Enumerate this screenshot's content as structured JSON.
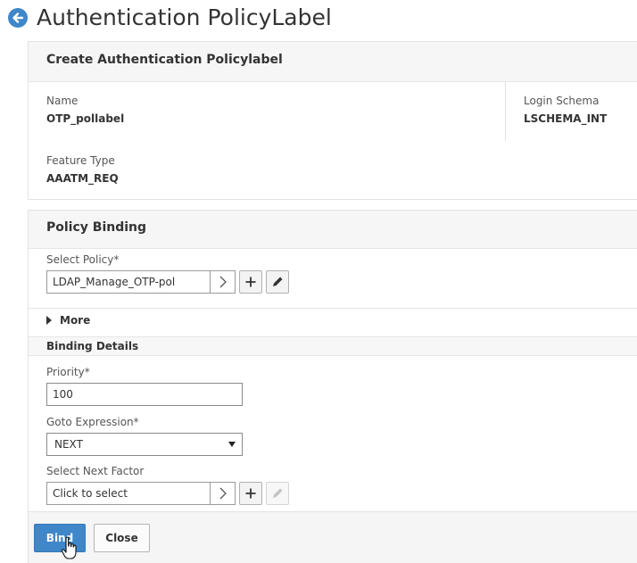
{
  "page": {
    "title": "Authentication PolicyLabel",
    "back_icon": "back-arrow-icon"
  },
  "create_panel": {
    "title": "Create Authentication Policylabel",
    "name_label": "Name",
    "name_value": "OTP_pollabel",
    "login_schema_label": "Login Schema",
    "login_schema_value": "LSCHEMA_INT",
    "feature_type_label": "Feature Type",
    "feature_type_value": "AAATM_REQ"
  },
  "binding_panel": {
    "title": "Policy Binding",
    "select_policy_label": "Select Policy*",
    "select_policy_value": "LDAP_Manage_OTP-pol",
    "more_label": "More",
    "binding_details_label": "Binding Details",
    "priority_label": "Priority*",
    "priority_value": "100",
    "goto_label": "Goto Expression*",
    "goto_value": "NEXT",
    "next_factor_label": "Select Next Factor",
    "next_factor_placeholder": "Click to select"
  },
  "footer": {
    "bind_label": "Bind",
    "close_label": "Close"
  },
  "colors": {
    "accent": "#3f87c9",
    "panel_header": "#f6f6f6",
    "border": "#e3e3e3"
  }
}
